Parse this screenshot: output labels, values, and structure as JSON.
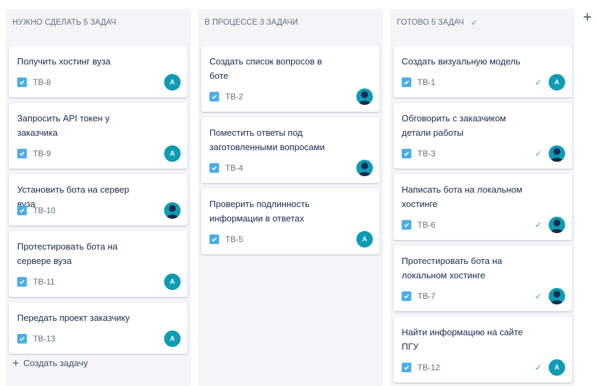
{
  "columns": [
    {
      "header": "НУЖНО СДЕЛАТЬ 5 ЗАДАЧ",
      "done": false,
      "create_label": "Создать задачу",
      "cards": [
        {
          "title": "Получить хостинг вуза",
          "key": "TB-8",
          "avatar": "A",
          "avatar_type": "letter"
        },
        {
          "title": "Запросить API токен у заказчика",
          "key": "TB-9",
          "avatar": "A",
          "avatar_type": "letter"
        },
        {
          "title": "Установить бота на сервер вуза",
          "key": "TB-10",
          "avatar": "",
          "avatar_type": "person"
        },
        {
          "title": "Протестировать бота на сервере вуза",
          "key": "TB-11",
          "avatar": "A",
          "avatar_type": "letter"
        },
        {
          "title": "Передать проект заказчику",
          "key": "TB-13",
          "avatar": "A",
          "avatar_type": "letter"
        }
      ]
    },
    {
      "header": "В ПРОЦЕССЕ 3 ЗАДАЧИ",
      "done": false,
      "cards": [
        {
          "title": "Создать список вопросов в боте",
          "key": "TB-2",
          "avatar": "",
          "avatar_type": "person"
        },
        {
          "title": "Поместить ответы под заготовленными вопросами",
          "key": "TB-4",
          "avatar": "",
          "avatar_type": "person"
        },
        {
          "title": "Проверить подлинность информации в ответах",
          "key": "TB-5",
          "avatar": "A",
          "avatar_type": "letter"
        }
      ]
    },
    {
      "header": "ГОТОВО 5 ЗАДАЧ",
      "done": true,
      "cards": [
        {
          "title": "Создать визуальную модель",
          "key": "TB-1",
          "avatar": "A",
          "avatar_type": "letter"
        },
        {
          "title": "Обговорить с заказчиком детали работы",
          "key": "TB-3",
          "avatar": "",
          "avatar_type": "person"
        },
        {
          "title": "Написать бота на локальном хостинге",
          "key": "TB-6",
          "avatar": "",
          "avatar_type": "person"
        },
        {
          "title": "Протестировать бота на локальном хостинге",
          "key": "TB-7",
          "avatar": "",
          "avatar_type": "person"
        },
        {
          "title": "Найти информацию на сайте ПГУ",
          "key": "TB-12",
          "avatar": "A",
          "avatar_type": "letter"
        }
      ]
    }
  ],
  "icons": {
    "checkbox": "checkbox-icon",
    "done": "checkmark-icon",
    "add": "plus-icon",
    "person": "person-avatar-icon"
  },
  "colors": {
    "column_bg": "#f4f5f7",
    "checkbox": "#4bade8",
    "done_check": "#36b37e",
    "avatar": "#0e9bb5"
  }
}
